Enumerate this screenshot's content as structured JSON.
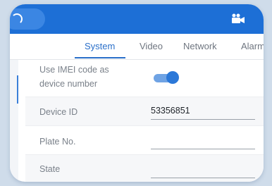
{
  "appbar": {
    "back_icon": "back-icon",
    "camera_icon": "video-camera-icon",
    "brand_color": "#1d6fd6"
  },
  "tabs": [
    {
      "label": "System",
      "active": true
    },
    {
      "label": "Video",
      "active": false
    },
    {
      "label": "Network",
      "active": false
    },
    {
      "label": "Alarm",
      "active": false
    }
  ],
  "settings": {
    "imei": {
      "label_line1": "Use IMEI code as",
      "label_line2": "device number",
      "enabled": true
    },
    "device_id": {
      "label": "Device ID",
      "value": "53356851"
    },
    "plate_no": {
      "label": "Plate No.",
      "value": ""
    },
    "state": {
      "label": "State",
      "value": ""
    }
  }
}
